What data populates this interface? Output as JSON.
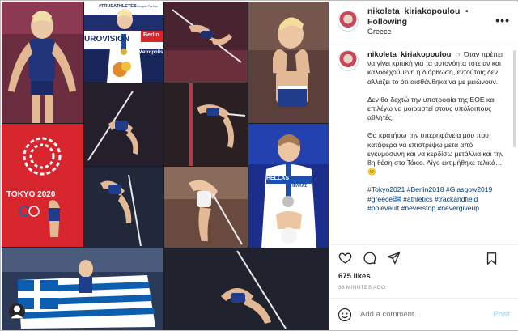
{
  "post": {
    "username": "nikoleta_kiriakopoulou",
    "separator": "•",
    "follow_state": "Following",
    "location": "Greece",
    "more_icon": "more-horizontal-icon",
    "caption_lines": [
      "☞ Όταν πρέπει να γίνει κριτική για τα αυτονόητα τότε αν και καλοδεχούμενη η διόρθωση, εντούτοις δεν αλλάζει το ότι αισθάνθηκα να με μειώνουν.",
      "Δεν θα δεχτώ την υποτροφία της ΕΟΕ και επιλέγω να μοιραστεί στους υπόλοιπους αθλητές.",
      "Θα κρατήσω την υπερηφάνεια μου που κατάφερα να επιστρέψω μετά από εγκυμοσυνη και να κερδίσω μετάλλια και την 8η θέση στο Τόκιο. Λίγο εκτιμήθηκε τελικά… 🙂"
    ],
    "hashtags": "#Tokyo2021 #Berlin2018 #Glasgow2019 #greece🇬🇷 #athletics #trackandfield #polevault #neverstop #nevergiveup",
    "likes": "675 likes",
    "timestamp": "38 MINUTES AGO",
    "comment_placeholder": "Add a comment…",
    "post_button": "Post"
  },
  "collage": {
    "banner_text": "#TRUEATHLETES",
    "banner_text2": "Principal Partner",
    "eurovision_text": "UROVISION",
    "berlin_text": "Berlin",
    "metropolis_text": "s Metropolis",
    "tokyo_text": "TOKYO 2020",
    "hellas_text": "HELLAS",
    "hellas_text2": "HEΛΛΑΣ"
  },
  "colors": {
    "link": "#00376b",
    "post_disabled": "#b2dffc",
    "greek_blue": "#0d5eaf",
    "tokyo_red": "#d7262e"
  }
}
